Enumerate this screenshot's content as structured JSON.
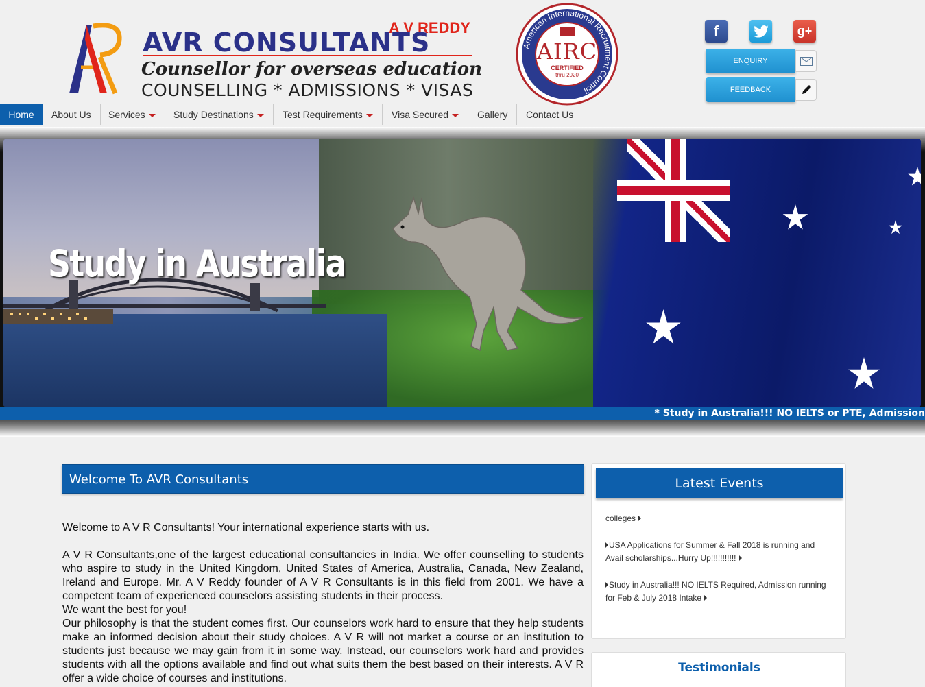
{
  "header": {
    "logo": {
      "reddy": "A V REDDY",
      "title": "AVR CONSULTANTS",
      "tagline": "Counsellor for overseas education",
      "services": "COUNSELLING * ADMISSIONS * VISAS"
    },
    "airc_badge": {
      "ring_text": "American International Recruitment Council",
      "name": "AIRC",
      "certified": "CERTIFIED",
      "thru": "thru 2020"
    },
    "social": {
      "facebook": "f",
      "google_plus": "g+"
    },
    "buttons": {
      "enquiry": "ENQUIRY",
      "feedback": "FEEDBACK"
    }
  },
  "nav": {
    "items": [
      {
        "label": "Home",
        "active": true
      },
      {
        "label": "About Us"
      },
      {
        "label": "Services",
        "dropdown": true
      },
      {
        "label": "Study Destinations",
        "dropdown": true
      },
      {
        "label": "Test Requirements",
        "dropdown": true
      },
      {
        "label": "Visa Secured",
        "dropdown": true
      },
      {
        "label": "Gallery"
      },
      {
        "label": "Contact Us"
      }
    ]
  },
  "banner": {
    "title": "Study in Australia",
    "ticker": "* Study in Australia!!! NO IELTS or PTE, Admission"
  },
  "welcome": {
    "heading": "Welcome To AVR Consultants",
    "intro": "Welcome to A V R Consultants! Your international experience starts with us.",
    "p1": "A V R Consultants,one of the largest educational consultancies in India. We offer counselling to students who aspire to study in the United Kingdom, United States of America, Australia, Canada, New Zealand, Ireland and Europe. Mr. A V Reddy founder of A V R Consultants is in this field  from 2001. We have a competent team of experienced counselors assisting students in their process.",
    "p2": "We want the best for you!",
    "p3": "Our philosophy is that the student comes first. Our counselors work hard to ensure that they help students make an informed decision about their study choices. A V R will not market a course or an institution to students just because we may gain from it in some way. Instead, our counselors work hard and provides students with all the options available and find out what suits them the best based on their interests. A V R offer a wide choice of courses and institutions."
  },
  "events": {
    "heading": "Latest Events",
    "items": [
      "colleges",
      "USA Applications for Summer & Fall 2018 is running and Avail scholarships...Hurry Up!!!!!!!!!!!",
      "Study in Australia!!! NO IELTS Required, Admission running for Feb & July 2018 Intake"
    ]
  },
  "testimonials": {
    "heading": "Testimonials"
  },
  "colors": {
    "primary_blue": "#0d5fac",
    "accent_red": "#c52222",
    "logo_navy": "#2b3189"
  }
}
